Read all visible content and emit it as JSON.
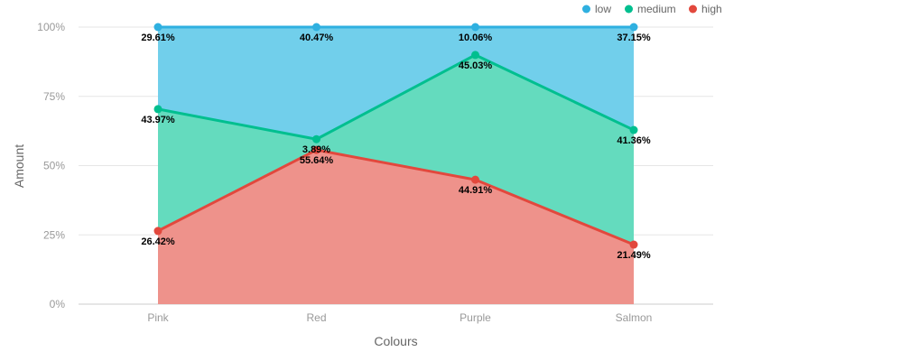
{
  "chart_data": {
    "type": "area",
    "stacking": "percent",
    "categories": [
      "Pink",
      "Red",
      "Purple",
      "Salmon"
    ],
    "series": [
      {
        "name": "low",
        "color": "#2fb0e0",
        "fill": "#71cfeb",
        "values": [
          29.61,
          40.47,
          10.06,
          37.15
        ]
      },
      {
        "name": "medium",
        "color": "#00bf8f",
        "fill": "#64dbbe",
        "values": [
          43.97,
          3.89,
          45.03,
          41.36
        ]
      },
      {
        "name": "high",
        "color": "#e2483d",
        "fill": "#ee928b",
        "values": [
          26.42,
          55.64,
          44.91,
          21.49
        ]
      }
    ],
    "xlabel": "Colours",
    "ylabel": "Amount",
    "y_ticks": [
      "0%",
      "25%",
      "50%",
      "75%",
      "100%"
    ],
    "ylim": [
      0,
      100
    ],
    "grid": true,
    "legend_position": "top-right"
  }
}
